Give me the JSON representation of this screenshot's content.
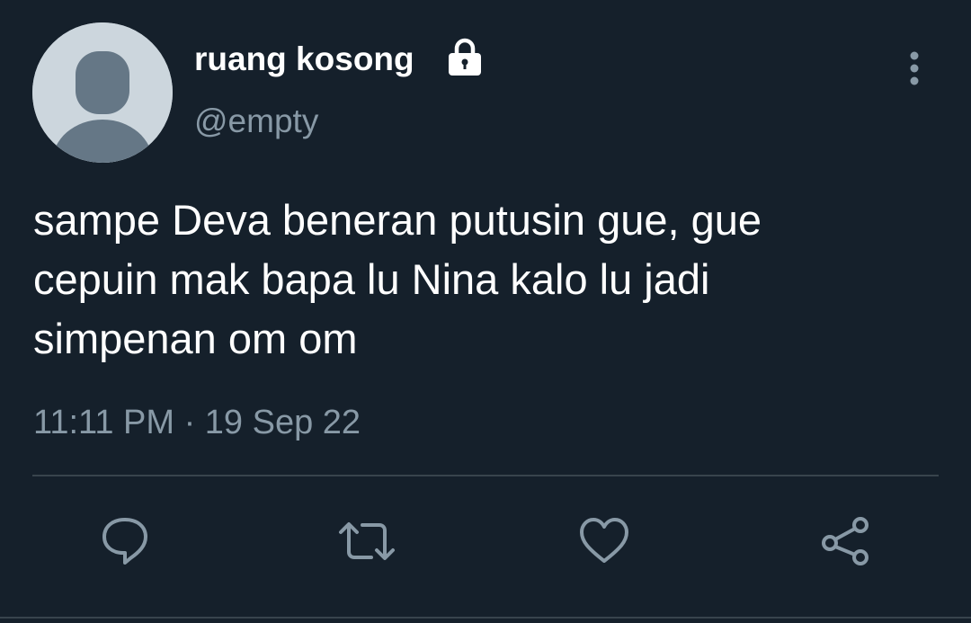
{
  "tweet": {
    "display_name": "ruang kosong",
    "handle": "@empty",
    "text_lines": [
      "sampe Deva beneran putusin gue, gue",
      "cepuin mak bapa lu Nina kalo lu jadi",
      "simpenan om om"
    ],
    "timestamp": "11:11 PM · 19 Sep 22"
  },
  "icons": {
    "lock": "lock-icon",
    "more": "more-vertical-icon",
    "reply": "reply-icon",
    "retweet": "retweet-icon",
    "like": "like-icon",
    "share": "share-icon"
  },
  "colors": {
    "background": "#15202b",
    "text_primary": "#ffffff",
    "text_secondary": "#8899a6",
    "icon": "#8899a6",
    "divider": "#38444d",
    "avatar_bg": "#ccd6dd",
    "avatar_figure": "#657786"
  }
}
